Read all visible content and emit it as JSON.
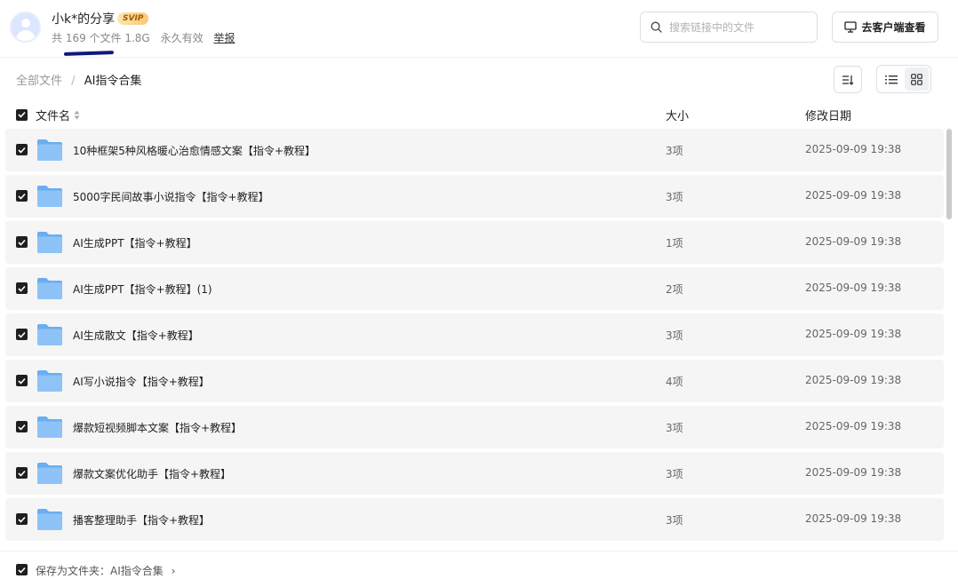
{
  "header": {
    "user_name": "小k*的分享",
    "badge": "SVIP",
    "file_count": "共 169 个文件 1.8G",
    "validity": "永久有效",
    "report": "举报",
    "search_placeholder": "搜索链接中的文件",
    "client_button": "去客户端查看"
  },
  "breadcrumb": {
    "root": "全部文件",
    "separator": "/",
    "current": "AI指令合集"
  },
  "columns": {
    "name": "文件名",
    "size": "大小",
    "date": "修改日期"
  },
  "files": [
    {
      "name": "10种框架5种风格暖心治愈情感文案【指令+教程】",
      "size": "3项",
      "date": "2025-09-09 19:38"
    },
    {
      "name": "5000字民间故事小说指令【指令+教程】",
      "size": "3项",
      "date": "2025-09-09 19:38"
    },
    {
      "name": "AI生成PPT【指令+教程】",
      "size": "1项",
      "date": "2025-09-09 19:38"
    },
    {
      "name": "AI生成PPT【指令+教程】(1)",
      "size": "2项",
      "date": "2025-09-09 19:38"
    },
    {
      "name": "AI生成散文【指令+教程】",
      "size": "3项",
      "date": "2025-09-09 19:38"
    },
    {
      "name": "AI写小说指令【指令+教程】",
      "size": "4项",
      "date": "2025-09-09 19:38"
    },
    {
      "name": "爆款短视频脚本文案【指令+教程】",
      "size": "3项",
      "date": "2025-09-09 19:38"
    },
    {
      "name": "爆款文案优化助手【指令+教程】",
      "size": "3项",
      "date": "2025-09-09 19:38"
    },
    {
      "name": "播客整理助手【指令+教程】",
      "size": "3项",
      "date": "2025-09-09 19:38"
    }
  ],
  "footer": {
    "save_label": "保存为文件夹：AI指令合集",
    "chevron": "›"
  },
  "colors": {
    "folder": "#8ec3f7",
    "folder_dark": "#6aaef2",
    "row_bg": "#f5f5f6",
    "checkbox": "#1f1f1f",
    "underline_mark": "#0e1a7a"
  }
}
